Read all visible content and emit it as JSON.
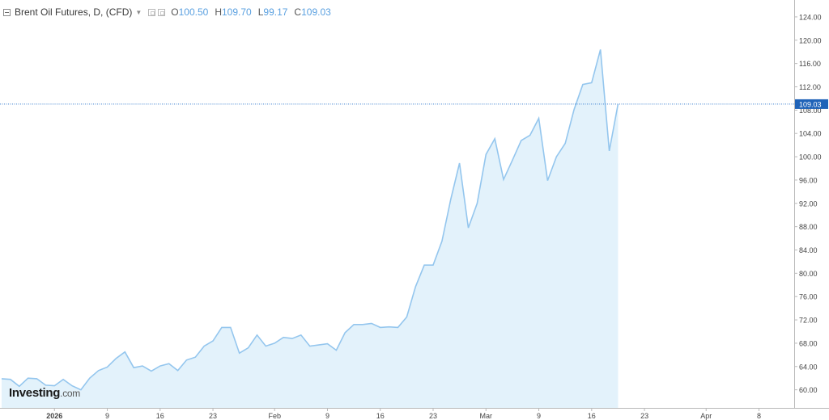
{
  "legend": {
    "title": "Brent Oil Futures, D, (CFD)",
    "open_label": "O",
    "open_value": "100.50",
    "high_label": "H",
    "high_value": "109.70",
    "low_label": "L",
    "low_value": "99.17",
    "close_label": "C",
    "close_value": "109.03"
  },
  "logo": {
    "name": "Investing",
    "suffix": ".com"
  },
  "colors": {
    "line": "#94c6ee",
    "fill": "#e3f2fb",
    "price_line": "#3a7fd0",
    "price_badge": "#1f63b8",
    "axis": "#b9b9b9",
    "text": "#444444"
  },
  "chart_data": {
    "type": "area",
    "ylim": [
      56.9,
      126.9
    ],
    "yticks": [
      60,
      64,
      68,
      72,
      76,
      80,
      84,
      88,
      92,
      96,
      100,
      104,
      108,
      112,
      116,
      120,
      124
    ],
    "ytick_labels": [
      "60.00",
      "64.00",
      "68.00",
      "72.00",
      "76.00",
      "80.00",
      "84.00",
      "88.00",
      "92.00",
      "96.00",
      "100.00",
      "104.00",
      "108.00",
      "112.00",
      "116.00",
      "120.00",
      "124.00"
    ],
    "xlim": [
      0,
      90
    ],
    "xticks": [
      {
        "x": 6,
        "label": "2026",
        "bold": true
      },
      {
        "x": 12,
        "label": "9"
      },
      {
        "x": 18,
        "label": "16"
      },
      {
        "x": 24,
        "label": "23"
      },
      {
        "x": 31,
        "label": "Feb"
      },
      {
        "x": 37,
        "label": "9"
      },
      {
        "x": 43,
        "label": "16"
      },
      {
        "x": 49,
        "label": "23"
      },
      {
        "x": 55,
        "label": "Mar"
      },
      {
        "x": 61,
        "label": "9"
      },
      {
        "x": 67,
        "label": "16"
      },
      {
        "x": 73,
        "label": "23"
      },
      {
        "x": 80,
        "label": "Apr"
      },
      {
        "x": 86,
        "label": "8"
      }
    ],
    "last_price": "109.03",
    "series": [
      {
        "values": [
          {
            "x": 0,
            "y": 61.9
          },
          {
            "x": 1,
            "y": 61.8
          },
          {
            "x": 2,
            "y": 60.6
          },
          {
            "x": 3,
            "y": 62.0
          },
          {
            "x": 4,
            "y": 61.9
          },
          {
            "x": 5,
            "y": 60.8
          },
          {
            "x": 6,
            "y": 60.7
          },
          {
            "x": 7,
            "y": 61.8
          },
          {
            "x": 8,
            "y": 60.7
          },
          {
            "x": 9,
            "y": 60.0
          },
          {
            "x": 10,
            "y": 62.0
          },
          {
            "x": 11,
            "y": 63.3
          },
          {
            "x": 12,
            "y": 63.9
          },
          {
            "x": 13,
            "y": 65.4
          },
          {
            "x": 14,
            "y": 66.5
          },
          {
            "x": 15,
            "y": 63.8
          },
          {
            "x": 16,
            "y": 64.1
          },
          {
            "x": 17,
            "y": 63.2
          },
          {
            "x": 18,
            "y": 64.1
          },
          {
            "x": 19,
            "y": 64.5
          },
          {
            "x": 20,
            "y": 63.3
          },
          {
            "x": 21,
            "y": 65.1
          },
          {
            "x": 22,
            "y": 65.6
          },
          {
            "x": 23,
            "y": 67.5
          },
          {
            "x": 24,
            "y": 68.4
          },
          {
            "x": 25,
            "y": 70.7
          },
          {
            "x": 26,
            "y": 70.7
          },
          {
            "x": 27,
            "y": 66.3
          },
          {
            "x": 28,
            "y": 67.2
          },
          {
            "x": 29,
            "y": 69.4
          },
          {
            "x": 30,
            "y": 67.5
          },
          {
            "x": 31,
            "y": 68.0
          },
          {
            "x": 32,
            "y": 69.0
          },
          {
            "x": 33,
            "y": 68.8
          },
          {
            "x": 34,
            "y": 69.4
          },
          {
            "x": 35,
            "y": 67.5
          },
          {
            "x": 36,
            "y": 67.7
          },
          {
            "x": 37,
            "y": 67.9
          },
          {
            "x": 38,
            "y": 66.8
          },
          {
            "x": 39,
            "y": 69.8
          },
          {
            "x": 40,
            "y": 71.2
          },
          {
            "x": 41,
            "y": 71.2
          },
          {
            "x": 42,
            "y": 71.4
          },
          {
            "x": 43,
            "y": 70.7
          },
          {
            "x": 44,
            "y": 70.8
          },
          {
            "x": 45,
            "y": 70.7
          },
          {
            "x": 46,
            "y": 72.5
          },
          {
            "x": 47,
            "y": 77.7
          },
          {
            "x": 48,
            "y": 81.4
          },
          {
            "x": 49,
            "y": 81.4
          },
          {
            "x": 50,
            "y": 85.5
          },
          {
            "x": 51,
            "y": 92.7
          },
          {
            "x": 52,
            "y": 98.9
          },
          {
            "x": 53,
            "y": 87.8
          },
          {
            "x": 54,
            "y": 92.0
          },
          {
            "x": 55,
            "y": 100.4
          },
          {
            "x": 56,
            "y": 103.1
          },
          {
            "x": 57,
            "y": 96.1
          },
          {
            "x": 58,
            "y": 99.4
          },
          {
            "x": 59,
            "y": 102.8
          },
          {
            "x": 60,
            "y": 103.7
          },
          {
            "x": 61,
            "y": 106.6
          },
          {
            "x": 62,
            "y": 95.9
          },
          {
            "x": 63,
            "y": 100.0
          },
          {
            "x": 64,
            "y": 102.3
          },
          {
            "x": 65,
            "y": 108.1
          },
          {
            "x": 66,
            "y": 112.4
          },
          {
            "x": 67,
            "y": 112.7
          },
          {
            "x": 68,
            "y": 118.4
          },
          {
            "x": 69,
            "y": 101.0
          },
          {
            "x": 70,
            "y": 109.03
          }
        ]
      }
    ]
  }
}
